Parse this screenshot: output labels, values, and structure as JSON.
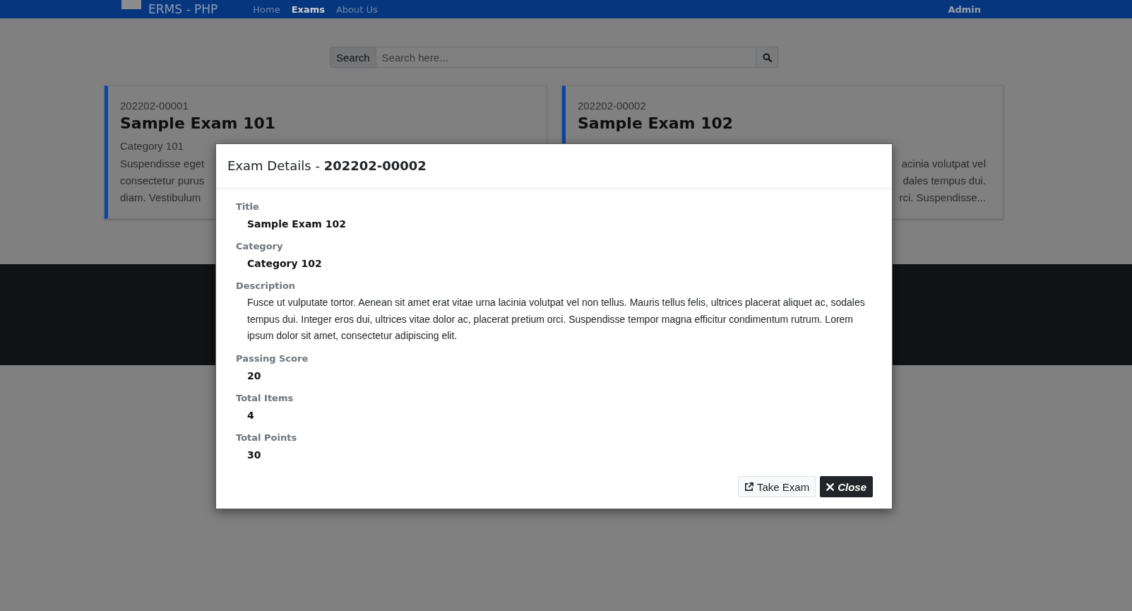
{
  "navbar": {
    "brand": "ERMS - PHP",
    "links": [
      {
        "label": "Home",
        "selected": false
      },
      {
        "label": "Exams",
        "selected": true
      },
      {
        "label": "About Us",
        "selected": false
      }
    ],
    "user": "Admin"
  },
  "search": {
    "label": "Search",
    "placeholder": "Search here..."
  },
  "exam_cards": [
    {
      "code": "202202-00001",
      "title": "Sample Exam 101",
      "category": "Category 101",
      "excerpt_lines": [
        "Suspendisse eget",
        "consectetur purus",
        "diam. Vestibulum"
      ]
    },
    {
      "code": "202202-00002",
      "title": "Sample Exam 102",
      "excerpt_lines": [
        "acinia volutpat vel",
        "dales tempus dui.",
        "rci. Suspendisse..."
      ]
    }
  ],
  "modal": {
    "title": "Exam Details - **202202-00002**",
    "fields": [
      {
        "label": "Title",
        "value": "Sample Exam 102",
        "kind": "strong"
      },
      {
        "label": "Category",
        "value": "Category 102",
        "kind": "strong"
      },
      {
        "label": "Description",
        "value": "Fusce ut vulputate tortor. Aenean sit amet erat vitae urna lacinia volutpat vel non tellus. Mauris tellus felis, ultrices placerat aliquet ac, sodales tempus dui. Integer eros dui, ultrices vitae dolor ac, placerat pretium orci. Suspendisse tempor magna efficitur condimentum rutrum. Lorem ipsum dolor sit amet, consectetur adipiscing elit.",
        "kind": "text"
      },
      {
        "label": "Passing Score",
        "value": "20",
        "kind": "strong"
      },
      {
        "label": "Total Items",
        "value": "4",
        "kind": "strong"
      },
      {
        "label": "Total Points",
        "value": "30",
        "kind": "strong"
      }
    ],
    "buttons": [
      {
        "label": "Take Exam",
        "kind": "light"
      },
      {
        "label": "Close",
        "kind": "dark"
      }
    ]
  }
}
